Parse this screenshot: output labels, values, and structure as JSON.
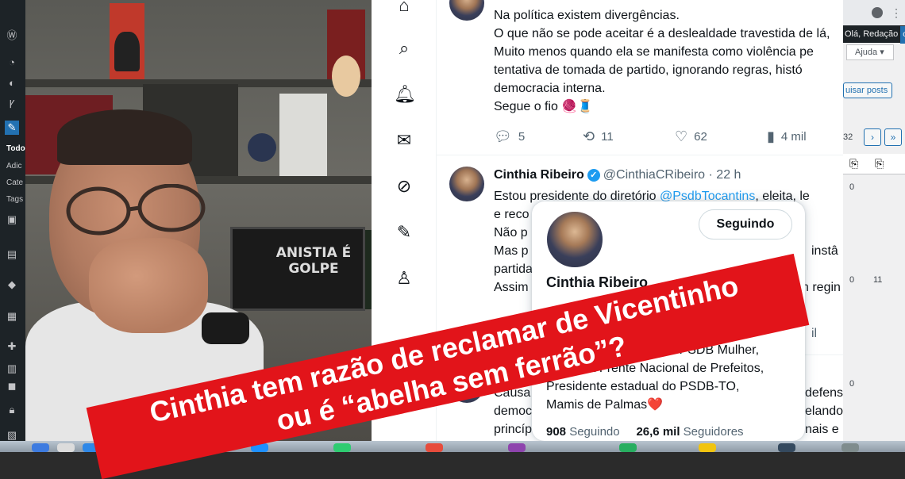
{
  "twitter": {
    "nav_icons": [
      "home-icon",
      "search-icon",
      "bell-icon",
      "mail-icon",
      "slash-icon",
      "compose-icon",
      "profile-icon"
    ],
    "tweet1": {
      "lines": [
        "Na política existem divergências.",
        "O que não se pode aceitar é a deslealdade travestida de lá,",
        "Muito menos quando ela se manifesta como violência pe",
        "tentativa de tomada de partido, ignorando regras, histó",
        "democracia interna.",
        "Segue o fio 🧶🧵"
      ],
      "replies": "5",
      "retweets": "11",
      "likes": "62",
      "views": "4 mil"
    },
    "tweet2": {
      "name": "Cinthia Ribeiro",
      "handle": "@CinthiaCRibeiro · 22 h",
      "line1_prefix": "Estou presidente do diretório ",
      "line1_mention": "@PsdbTocantins",
      "line1_suffix": ", eleita, le",
      "lines": [
        "e reco",
        "Não p",
        "Mas p",
        "partida",
        "Assim"
      ],
      "right_fragments": [
        "instâ",
        "n regin"
      ],
      "more_link": "il"
    },
    "tweet3": {
      "lines": [
        "Causa",
        "democ",
        "princíp"
      ],
      "right_fragments": [
        "defens",
        "elando",
        "nais e"
      ]
    },
    "hover_card": {
      "follow_button": "Seguindo",
      "name": "Cinthia Ribeiro",
      "bio": [
        "d do PSDB Mulher,",
        "2º VP da Frente Nacional de Prefeitos,",
        "Presidente estadual do PSDB-TO,",
        "Mamis de Palmas❤️"
      ],
      "following_count": "908",
      "following_label": "Seguindo",
      "followers_count": "26,6 mil",
      "followers_label": "Seguidores"
    }
  },
  "video": {
    "sign_text": "ANISTIA É GOLPE"
  },
  "wordpress": {
    "sidebar_labels": [
      "Todo",
      "Adic",
      "Cate",
      "Tags"
    ],
    "admin_bar_text": "Olá, Redação",
    "admin_bar_badge": "ct",
    "help_button": "Ajuda ▾",
    "search_button": "uisar posts",
    "pager_count": "32",
    "pager_next": "›",
    "pager_last": "»",
    "values": [
      "0",
      "0",
      "11",
      "0"
    ]
  },
  "banner": {
    "line1": "Cinthia tem razão de reclamar de Vicentinho",
    "line2": "ou é “abelha sem ferrão”?",
    "color": "#e2141a"
  }
}
